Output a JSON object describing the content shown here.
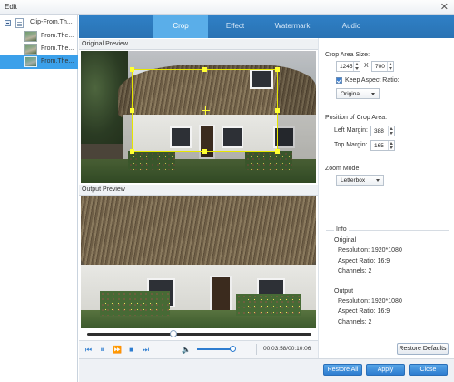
{
  "window": {
    "title": "Edit",
    "close_glyph": "✕"
  },
  "sidebar": {
    "items": [
      {
        "label": "Clip-From.Th...",
        "icon": "doc-icon",
        "selected": false
      },
      {
        "label": "From.The...",
        "icon": "thumbnail",
        "selected": false
      },
      {
        "label": "From.The...",
        "icon": "thumbnail",
        "selected": false
      },
      {
        "label": "From.The...",
        "icon": "thumbnail",
        "selected": true
      }
    ]
  },
  "tabs": [
    {
      "label": "Crop",
      "active": true
    },
    {
      "label": "Effect",
      "active": false
    },
    {
      "label": "Watermark",
      "active": false
    },
    {
      "label": "Audio",
      "active": false
    }
  ],
  "preview": {
    "original_label": "Original Preview",
    "output_label": "Output Preview"
  },
  "player": {
    "time": "00:03:58/00:10:06",
    "progress": 0.38,
    "volume": 0.85
  },
  "crop": {
    "area_size_label": "Crop Area Size:",
    "width": "1245",
    "x_sep": "X",
    "height": "700",
    "keep_aspect_label": "Keep Aspect Ratio:",
    "keep_aspect_checked": true,
    "aspect_value": "Original",
    "position_label": "Position of Crop Area:",
    "left_margin_label": "Left Margin:",
    "left_margin": "388",
    "top_margin_label": "Top Margin:",
    "top_margin": "165",
    "zoom_label": "Zoom Mode:",
    "zoom_value": "Letterbox"
  },
  "info": {
    "heading": "Info",
    "original": {
      "heading": "Original",
      "resolution": "Resolution: 1920*1080",
      "aspect": "Aspect Ratio: 16:9",
      "channels": "Channels: 2"
    },
    "output": {
      "heading": "Output",
      "resolution": "Resolution: 1920*1080",
      "aspect": "Aspect Ratio: 16:9",
      "channels": "Channels: 2"
    }
  },
  "buttons": {
    "restore_defaults": "Restore Defaults",
    "restore_all": "Restore All",
    "apply": "Apply",
    "close": "Close"
  },
  "colors": {
    "accent": "#2e7dd0",
    "tab_active": "#5aaee9",
    "crop_frame": "#ffff33",
    "selected_row": "#3ba0ea"
  }
}
